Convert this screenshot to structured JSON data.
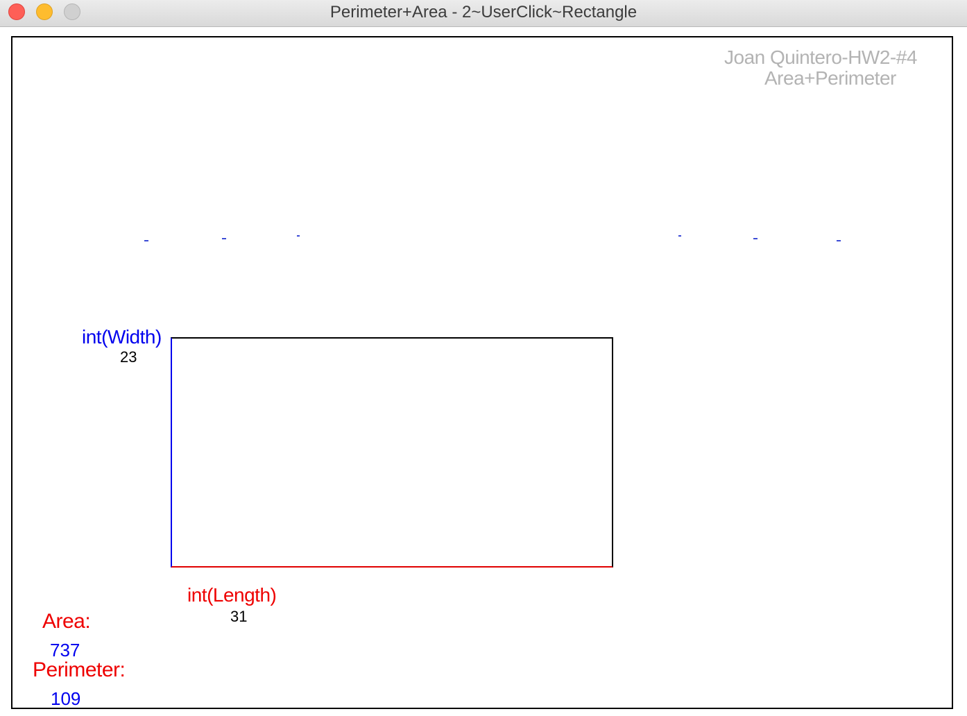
{
  "window": {
    "title": "Perimeter+Area - 2~UserClick~Rectangle"
  },
  "canvas": {
    "credit_line1": "Joan Quintero-HW2-#4",
    "credit_line2": "Area+Perimeter",
    "width_label": "int(Width)",
    "width_value": "23",
    "length_label": "int(Length)",
    "length_value": "31",
    "area_label": "Area:",
    "area_value": "737",
    "perimeter_label": "Perimeter:",
    "perimeter_value": "109"
  },
  "colors": {
    "width_side": "#0000ee",
    "length_side": "#ee0000",
    "credit_text": "#b3b3b3"
  }
}
